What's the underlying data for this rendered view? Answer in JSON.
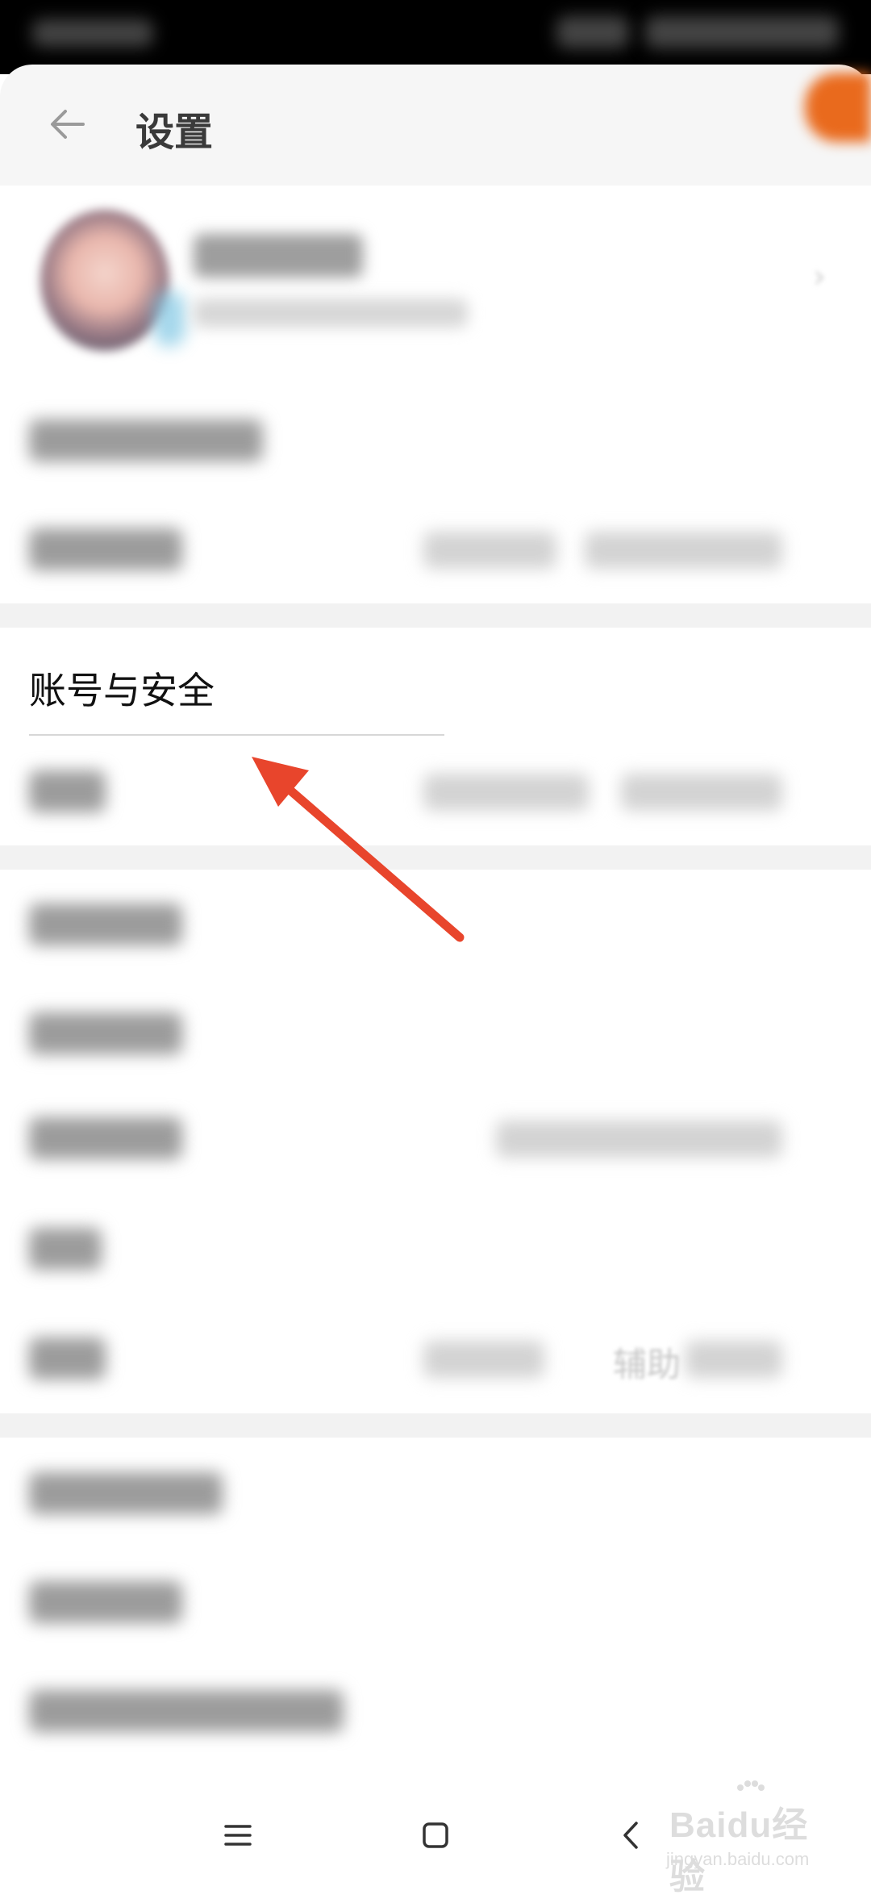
{
  "header": {
    "title": "设置"
  },
  "account_section": {
    "label": "账号与安全"
  },
  "partial_value": "辅助",
  "watermark": {
    "logo": "Baidu经验",
    "sub": "jingyan.baidu.com"
  },
  "colors": {
    "arrow": "#e8452c",
    "orange": "#e96a1d"
  },
  "icons": {
    "back": "back-arrow-icon",
    "chevron": "chevron-right-icon",
    "nav_menu": "menu-icon",
    "nav_home": "home-square-icon",
    "nav_back": "nav-back-icon"
  }
}
